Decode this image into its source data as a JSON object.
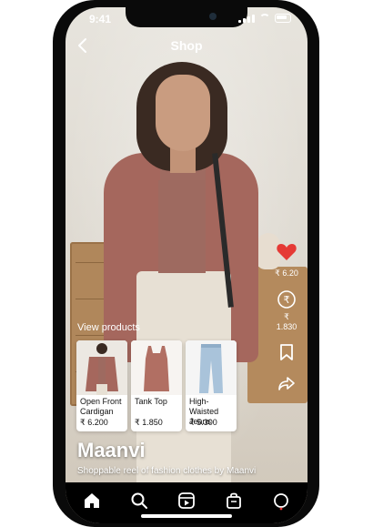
{
  "status": {
    "time": "9:41"
  },
  "nav": {
    "title": "Shop"
  },
  "actions": {
    "like_count": "₹ 6.20",
    "tip_count": "₹ 1.830"
  },
  "products_label": "View products",
  "products": [
    {
      "name": "Open Front Cardigan",
      "price": "₹ 6.200"
    },
    {
      "name": "Tank Top",
      "price": "₹ 1.850"
    },
    {
      "name": "High-Waisted Jeans",
      "price": "₹ 5.300"
    }
  ],
  "reel": {
    "creator": "Maanvi",
    "caption": "Shoppable reel of fashion clothes by Maanvi"
  },
  "colors": {
    "like": "#e53935",
    "cardigan": "#a5675d",
    "jeans": "#a9c3da"
  },
  "icons": [
    "back-icon",
    "heart-icon",
    "rupee-tip-icon",
    "bookmark-icon",
    "share-icon",
    "home-icon",
    "search-icon",
    "reels-icon",
    "shop-icon",
    "profile-icon"
  ]
}
